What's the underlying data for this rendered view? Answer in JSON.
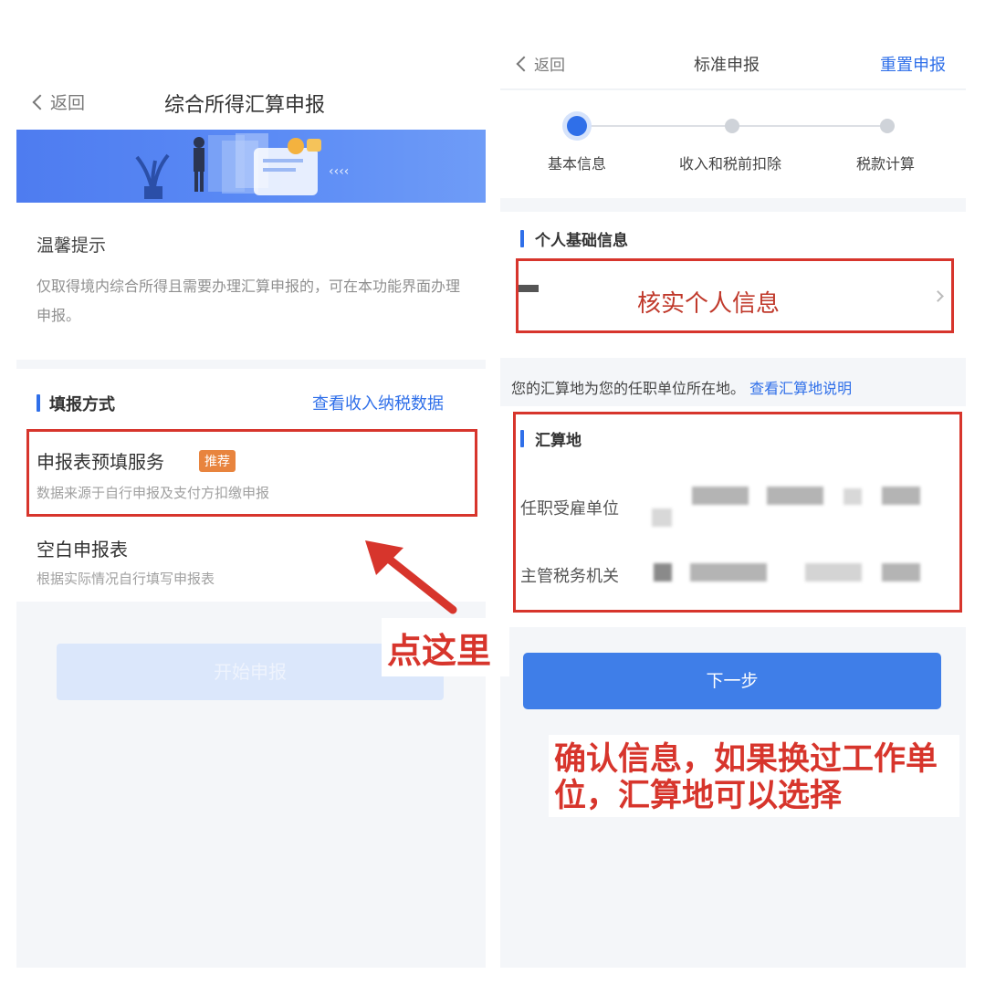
{
  "left_screen": {
    "back_label": "返回",
    "title": "综合所得汇算申报",
    "tips": {
      "title": "温馨提示",
      "body": "仅取得境内综合所得且需要办理汇算申报的，可在本功能界面办理申报。"
    },
    "method": {
      "title": "填报方式",
      "link": "查看收入纳税数据",
      "options": [
        {
          "title": "申报表预填服务",
          "badge": "推荐",
          "subtitle": "数据来源于自行申报及支付方扣缴申报"
        },
        {
          "title": "空白申报表",
          "subtitle": "根据实际情况自行填写申报表"
        }
      ]
    },
    "start_button": "开始申报"
  },
  "right_screen": {
    "back_label": "返回",
    "title": "标准申报",
    "reset_label": "重置申报",
    "steps": [
      {
        "label": "基本信息",
        "active": true
      },
      {
        "label": "收入和税前扣除",
        "active": false
      },
      {
        "label": "税款计算",
        "active": false
      }
    ],
    "personal_section": {
      "title": "个人基础信息",
      "verify_label": "核实个人信息"
    },
    "note": {
      "text": "您的汇算地为您的任职单位所在地。",
      "link": "查看汇算地说明"
    },
    "calc_section": {
      "title": "汇算地",
      "rows": [
        {
          "label": "任职受雇单位"
        },
        {
          "label": "主管税务机关"
        }
      ]
    },
    "next_button": "下一步"
  },
  "annotations": {
    "click_here": "点这里",
    "confirm_note": "确认信息，如果换过工作单位，汇算地可以选择"
  },
  "colors": {
    "brand_blue": "#2f6fe9",
    "button_blue": "#3f7ee8",
    "annotation_red": "#d7352c",
    "badge_orange": "#e8843e"
  }
}
